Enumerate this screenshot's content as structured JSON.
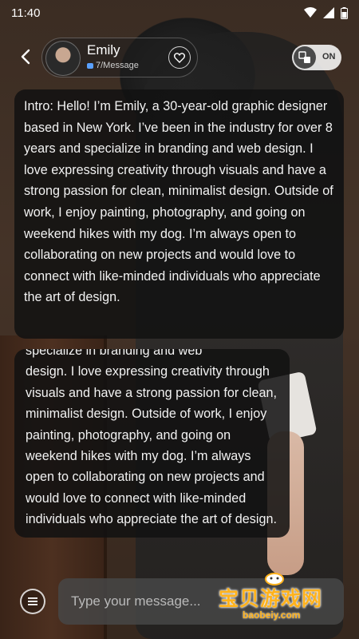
{
  "status_bar": {
    "time": "11:40"
  },
  "header": {
    "name": "Emily",
    "subtitle": "7/Message",
    "toggle_label": "ON"
  },
  "messages": {
    "intro": "Intro: Hello! I’m Emily, a 30-year-old graphic designer based in New York. I’ve been in the industry for over 8 years and specialize in branding and web design. I love expressing creativity through visuals and have a strong passion for clean, minimalist design. Outside of work, I enjoy painting, photography, and going on weekend hikes with my dog. I’m always open to collaborating on new projects and would love to connect with like-minded individuals who appreciate the art of design.",
    "reply_partial": "specialize in branding and web",
    "reply": "design. I love expressing creativity through visuals and have a strong passion for clean, minimalist design. Outside of work, I enjoy painting, photography, and going on weekend hikes with my dog. I’m always open to collaborating on new projects and would love to connect with like-minded individuals who appreciate the art of design."
  },
  "input": {
    "placeholder": "Type your message..."
  },
  "watermark": {
    "main": "宝贝游戏网",
    "sub": "baobeiy.com"
  },
  "colors": {
    "accent_watermark": "#ffb21c",
    "message_dot": "#5aa0ff"
  }
}
